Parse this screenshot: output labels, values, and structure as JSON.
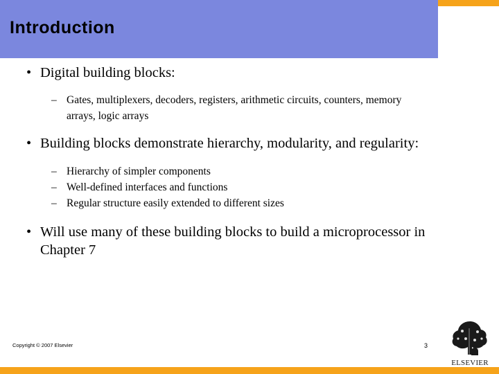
{
  "slide": {
    "title": "Introduction",
    "page_number": "3",
    "copyright": "Copyright © 2007 Elsevier",
    "logo_text": "ELSEVIER",
    "colors": {
      "title_band": "#7b87de",
      "accent_bar": "#f6a31a",
      "text": "#000000",
      "background": "#ffffff"
    },
    "markers": {
      "level1": "•",
      "level2": "–"
    },
    "bullets": [
      {
        "level": 1,
        "text": "Digital building blocks:"
      },
      {
        "level": 2,
        "text": "Gates, multiplexers, decoders, registers, arithmetic circuits, counters, memory arrays, logic arrays"
      },
      {
        "level": 1,
        "text": "Building blocks demonstrate hierarchy, modularity, and regularity:"
      },
      {
        "level": 2,
        "text": "Hierarchy of simpler components"
      },
      {
        "level": 2,
        "text": "Well-defined interfaces and functions"
      },
      {
        "level": 2,
        "text": "Regular structure easily extended to different sizes"
      },
      {
        "level": 1,
        "text": "Will use many of these building blocks to build a microprocessor in Chapter 7"
      }
    ]
  }
}
